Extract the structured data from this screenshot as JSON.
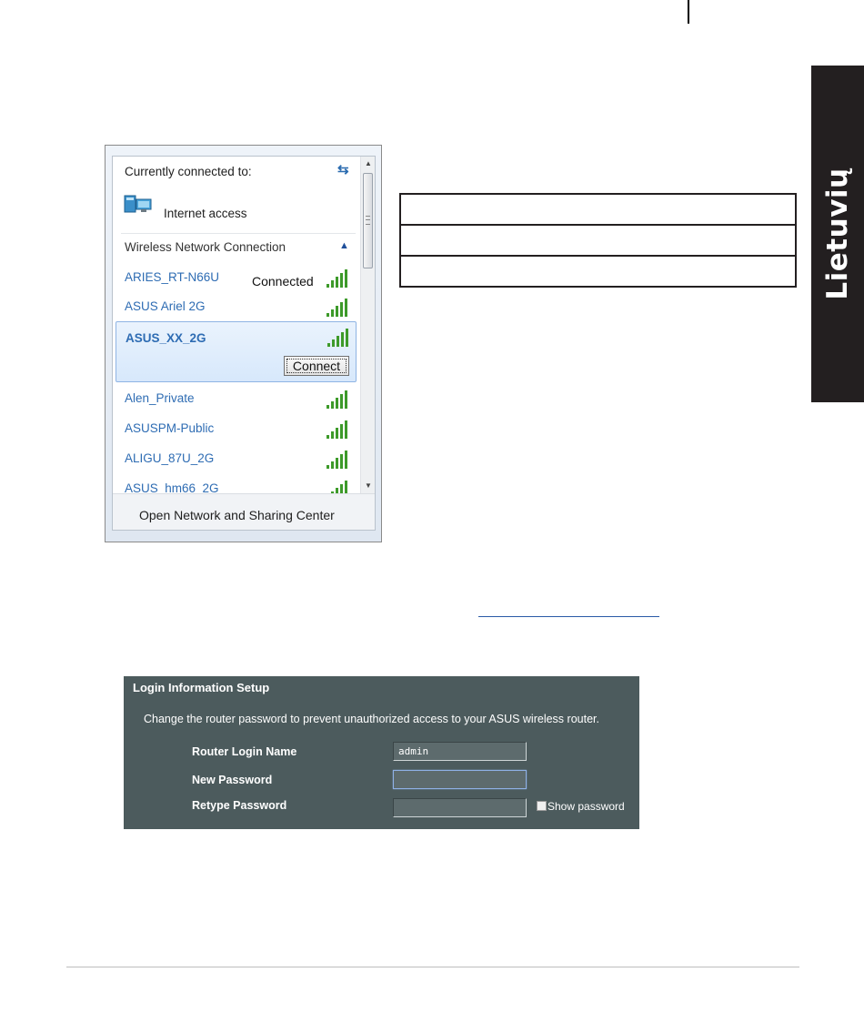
{
  "side_tab": {
    "label": "Lietuvių"
  },
  "wifi_popup": {
    "currently_connected_label": "Currently connected to:",
    "internet_access_label": "Internet access",
    "section_title": "Wireless Network Connection",
    "networks": [
      {
        "name": "ARIES_RT-N66U",
        "status": "Connected"
      },
      {
        "name": "ASUS Ariel 2G",
        "status": ""
      },
      {
        "name": "ASUS_XX_2G",
        "status": "",
        "selected": true,
        "button": "Connect"
      },
      {
        "name": "Alen_Private",
        "status": ""
      },
      {
        "name": "ASUSPM-Public",
        "status": ""
      },
      {
        "name": "ALIGU_87U_2G",
        "status": ""
      },
      {
        "name": "ASUS_hm66_2G",
        "status": ""
      }
    ],
    "footer_link": "Open Network and Sharing Center",
    "signal_color": "#3d9a2a",
    "link_color": "#2e6cb3"
  },
  "login_panel": {
    "title": "Login Information Setup",
    "description": "Change the router password to prevent unauthorized access to your ASUS wireless router.",
    "fields": [
      {
        "label": "Router Login Name",
        "value": "admin"
      },
      {
        "label": "New Password",
        "value": ""
      },
      {
        "label": "Retype Password",
        "value": ""
      }
    ],
    "show_password_label": "Show password",
    "background_color": "#4c5b5d"
  }
}
